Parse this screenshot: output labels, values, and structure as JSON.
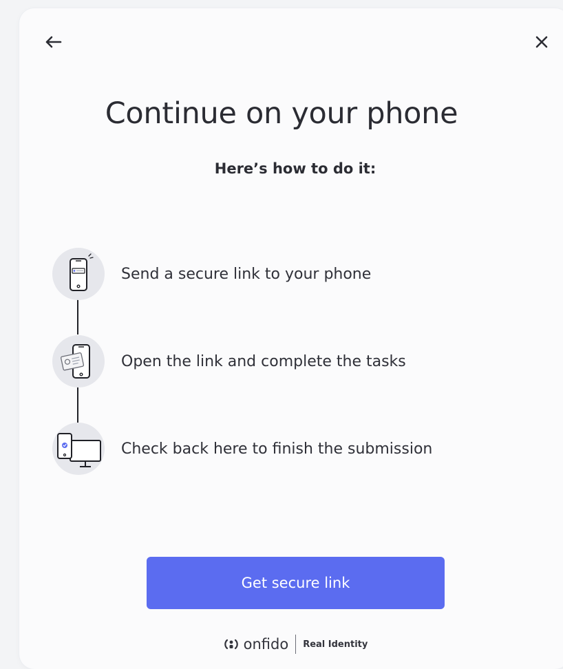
{
  "title": "Continue on your phone",
  "subtitle": "Here’s how to do it:",
  "steps": [
    {
      "label": "Send a secure link to your phone",
      "icon": "phone-with-link-icon"
    },
    {
      "label": "Open the link and complete the tasks",
      "icon": "phone-with-document-icon"
    },
    {
      "label": "Check back here to finish the submission",
      "icon": "phone-and-desktop-icon"
    }
  ],
  "primary_button": {
    "label": "Get secure link"
  },
  "header": {
    "back_icon": "arrow-left-icon",
    "close_icon": "close-icon"
  },
  "footer": {
    "brand": "onfido",
    "tagline": "Real Identity"
  },
  "colors": {
    "accent": "#5b6cf0",
    "background": "#fbfbfc",
    "text": "#2b2c33"
  }
}
